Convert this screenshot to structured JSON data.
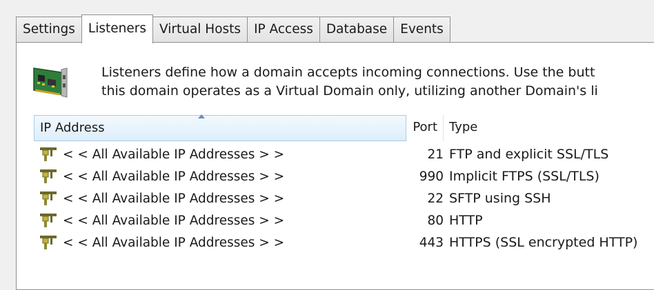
{
  "tabs": [
    {
      "label": "Settings"
    },
    {
      "label": "Listeners",
      "active": true
    },
    {
      "label": "Virtual Hosts"
    },
    {
      "label": "IP Access"
    },
    {
      "label": "Database"
    },
    {
      "label": "Events"
    }
  ],
  "description": {
    "icon": "network-card-icon",
    "line1": "Listeners define how a domain accepts incoming connections. Use the butt",
    "line2": "this domain operates as a Virtual Domain only, utilizing another Domain's li"
  },
  "table": {
    "columns": [
      "IP Address",
      "Port",
      "Type"
    ],
    "sorted_column": "IP Address",
    "row_icon": "listener-plug-icon",
    "rows": [
      {
        "ip": "< < All Available IP Addresses > >",
        "port": "21",
        "type": "FTP and explicit SSL/TLS"
      },
      {
        "ip": "< < All Available IP Addresses > >",
        "port": "990",
        "type": "Implicit FTPS (SSL/TLS)"
      },
      {
        "ip": "< < All Available IP Addresses > >",
        "port": "22",
        "type": "SFTP using SSH"
      },
      {
        "ip": "< < All Available IP Addresses > >",
        "port": "80",
        "type": "HTTP"
      },
      {
        "ip": "< < All Available IP Addresses > >",
        "port": "443",
        "type": "HTTPS (SSL encrypted HTTP)"
      }
    ]
  },
  "colors": {
    "header_highlight": "#ddeefb",
    "panel_bg": "#ffffff",
    "window_bg": "#f0f0f0"
  }
}
